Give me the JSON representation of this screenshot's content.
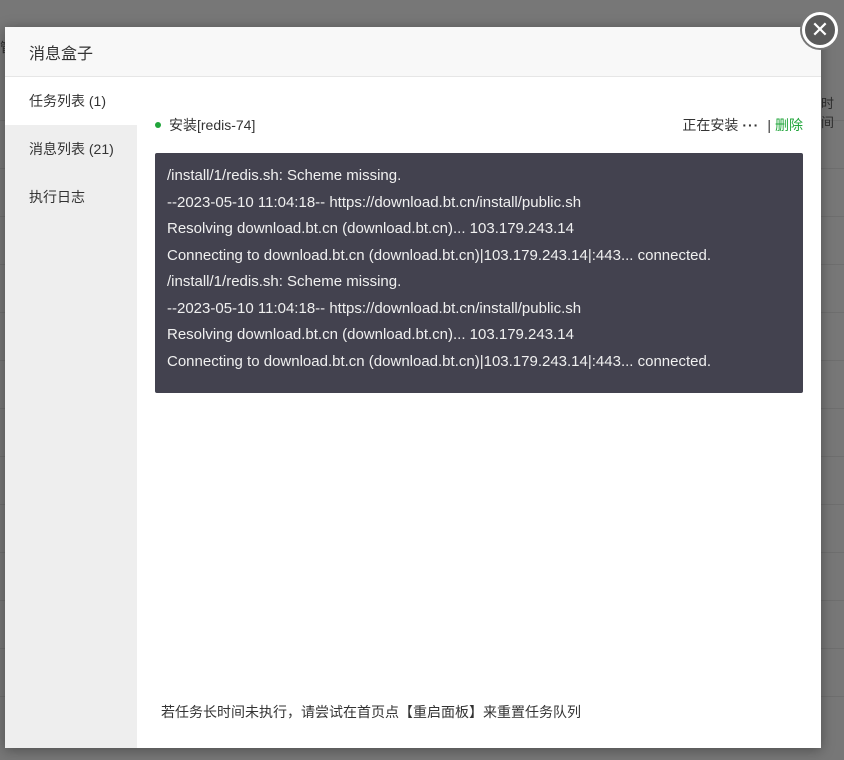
{
  "background": {
    "right_header_fragment": "时间",
    "left_fragment": "管"
  },
  "modal": {
    "title": "消息盒子",
    "close_icon": "close-icon"
  },
  "sidebar": {
    "items": [
      {
        "label": "任务列表 (1)",
        "active": true
      },
      {
        "label": "消息列表 (21)",
        "active": false
      },
      {
        "label": "执行日志",
        "active": false
      }
    ]
  },
  "task": {
    "name": "安装[redis-74]",
    "status": "正在安装",
    "separator": "|",
    "delete_label": "删除",
    "status_color": "#20a53a"
  },
  "log": {
    "lines": [
      "/install/1/redis.sh: Scheme missing.",
      "--2023-05-10 11:04:18-- https://download.bt.cn/install/public.sh",
      "Resolving download.bt.cn (download.bt.cn)... 103.179.243.14",
      "Connecting to download.bt.cn (download.bt.cn)|103.179.243.14|:443... connected.",
      "/install/1/redis.sh: Scheme missing.",
      "--2023-05-10 11:04:18--  https://download.bt.cn/install/public.sh",
      "Resolving download.bt.cn (download.bt.cn)... 103.179.243.14",
      "Connecting to download.bt.cn (download.bt.cn)|103.179.243.14|:443... connected."
    ]
  },
  "footer": {
    "tip": "若任务长时间未执行，请尝试在首页点【重启面板】来重置任务队列"
  }
}
